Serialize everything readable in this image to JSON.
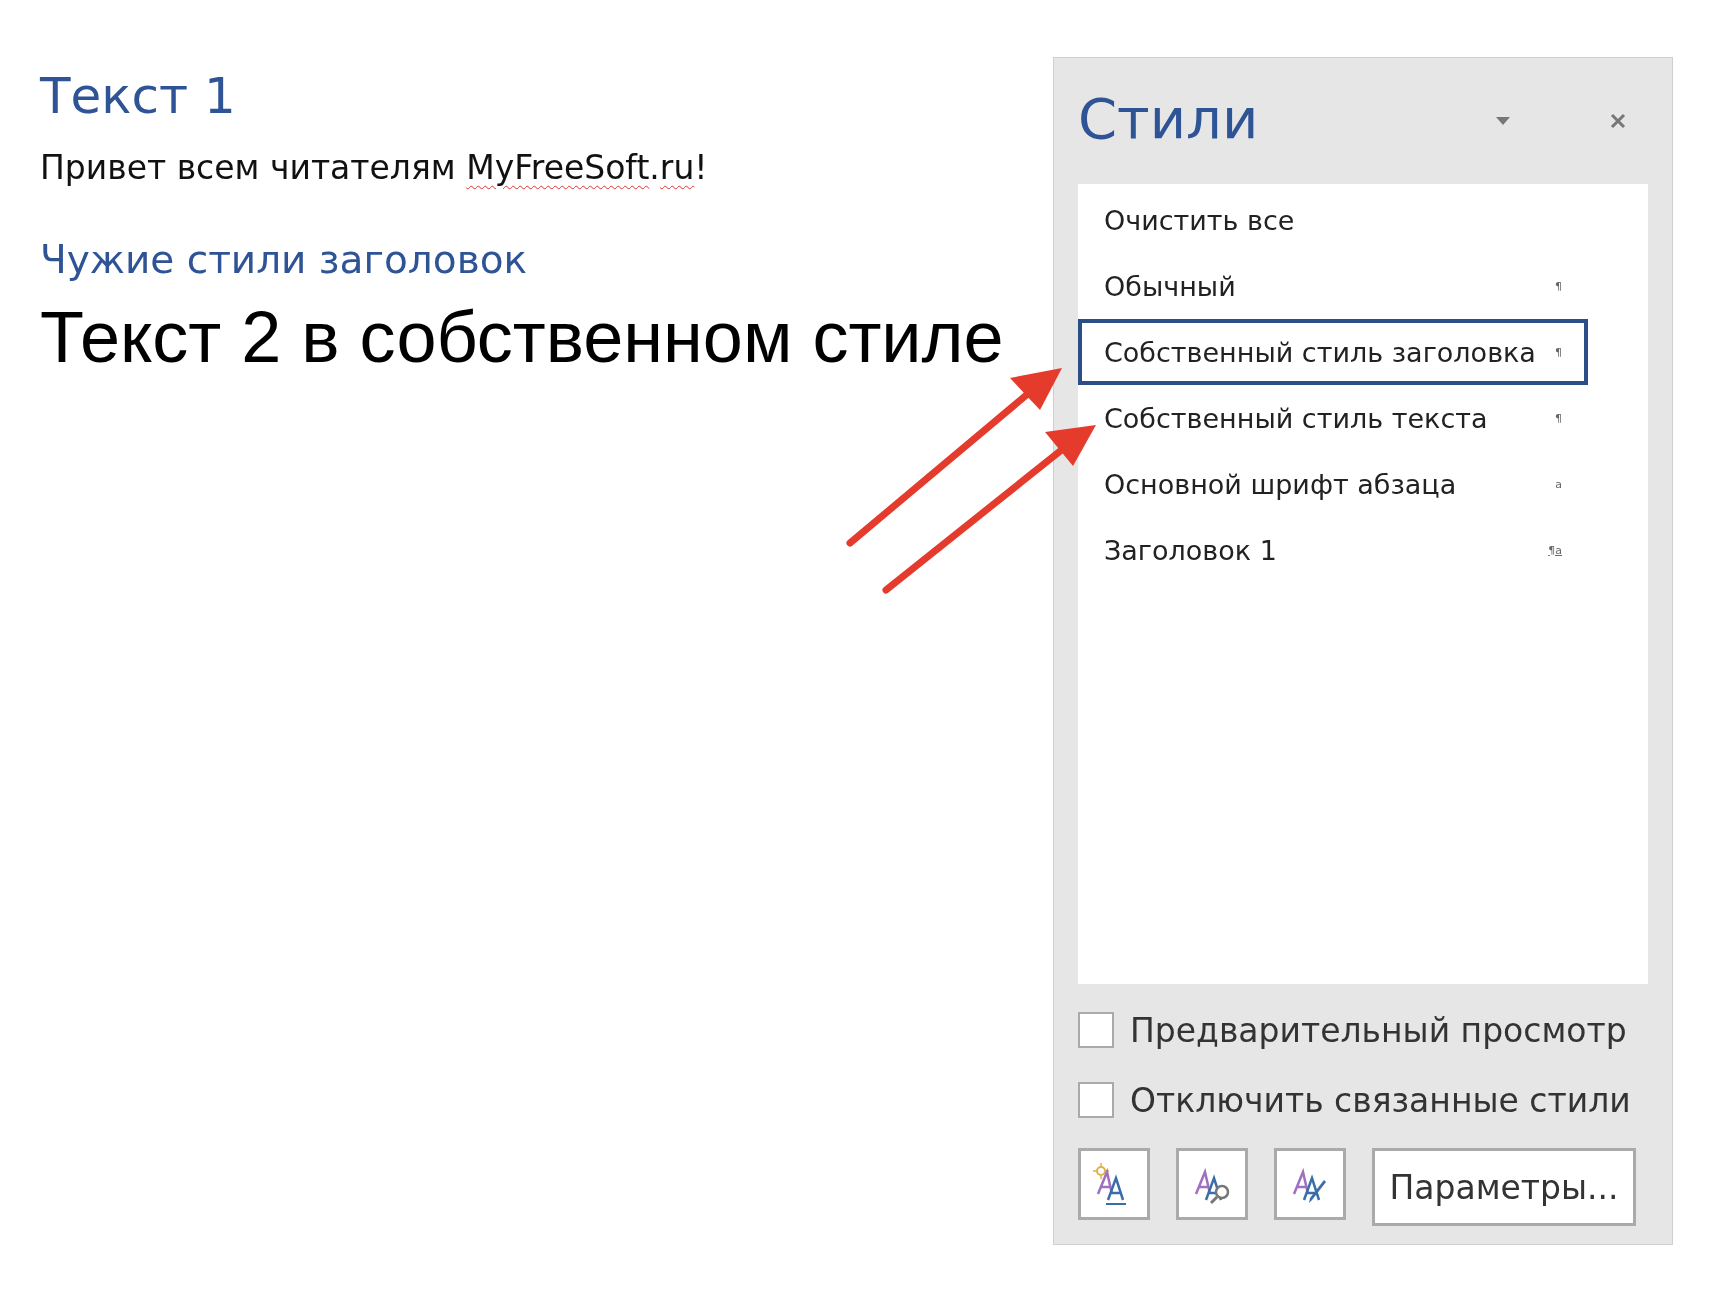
{
  "document": {
    "heading_1": "Текст 1",
    "paragraph": [
      {
        "text": "Привет всем читателям ",
        "misspelled": false
      },
      {
        "text": "MyFreeSoft",
        "misspelled": true
      },
      {
        "text": ".",
        "misspelled": false
      },
      {
        "text": "ru",
        "misspelled": true
      },
      {
        "text": "!",
        "misspelled": false
      }
    ],
    "heading_2": "Чужие стили заголовок",
    "custom_heading": "Текст 2 в собственном стиле"
  },
  "styles_pane": {
    "title": "Стили",
    "items": [
      {
        "label": "Очистить все",
        "selected": false
      },
      {
        "label": "Обычный",
        "marker": "¶",
        "selected": false
      },
      {
        "label": "Собственный стиль заголовка",
        "marker": "¶",
        "selected": true
      },
      {
        "label": "Собственный стиль текста",
        "marker": "¶",
        "selected": false
      },
      {
        "label": "Основной шрифт абзаца",
        "marker": "a",
        "selected": false
      },
      {
        "label": "Заголовок 1",
        "marker": "¶a",
        "selected": false
      }
    ],
    "options": [
      {
        "label": "Предварительный просмотр",
        "checked": false
      },
      {
        "label": "Отключить связанные стили",
        "checked": false
      }
    ],
    "tool_buttons": [
      {
        "kind": "new"
      },
      {
        "kind": "inspect"
      },
      {
        "kind": "manage"
      }
    ],
    "options_button": "Параметры..."
  }
}
